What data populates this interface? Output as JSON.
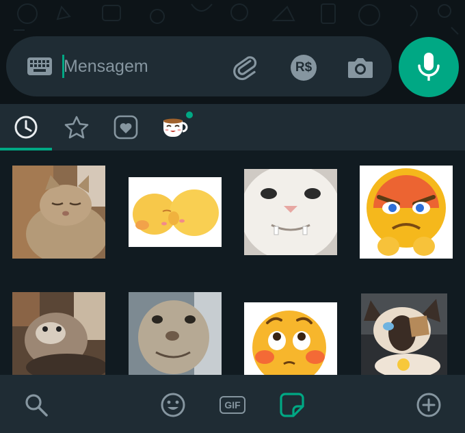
{
  "composer": {
    "placeholder": "Mensagem",
    "keyboard_icon": "keyboard-icon",
    "attach_icon": "paperclip-icon",
    "payment_label": "R$",
    "camera_icon": "camera-icon",
    "mic_icon": "microphone-icon"
  },
  "sticker_tabs": [
    {
      "name": "recent",
      "icon": "clock-icon",
      "selected": true
    },
    {
      "name": "starred",
      "icon": "star-icon",
      "selected": false
    },
    {
      "name": "favorites",
      "icon": "heart-icon",
      "selected": false
    },
    {
      "name": "pack",
      "icon": "coffee-cup-sticker-icon",
      "selected": false,
      "has_new": true
    }
  ],
  "stickers": [
    {
      "id": "sticker-cat-relaxed"
    },
    {
      "id": "sticker-two-emoji-blobs"
    },
    {
      "id": "sticker-cat-closeup-teeth"
    },
    {
      "id": "sticker-angry-emoji"
    },
    {
      "id": "sticker-cat-blurry"
    },
    {
      "id": "sticker-kitten-closeup"
    },
    {
      "id": "sticker-blushing-emoji"
    },
    {
      "id": "sticker-siamese-cat"
    }
  ],
  "bottom_bar": {
    "search_icon": "search-icon",
    "emoji_icon": "emoji-icon",
    "gif_label": "GIF",
    "sticker_icon": "sticker-icon",
    "add_icon": "add-icon"
  },
  "colors": {
    "accent": "#00a884",
    "panel": "#111b21",
    "bar": "#1f2c34",
    "icon": "#8696a0"
  }
}
